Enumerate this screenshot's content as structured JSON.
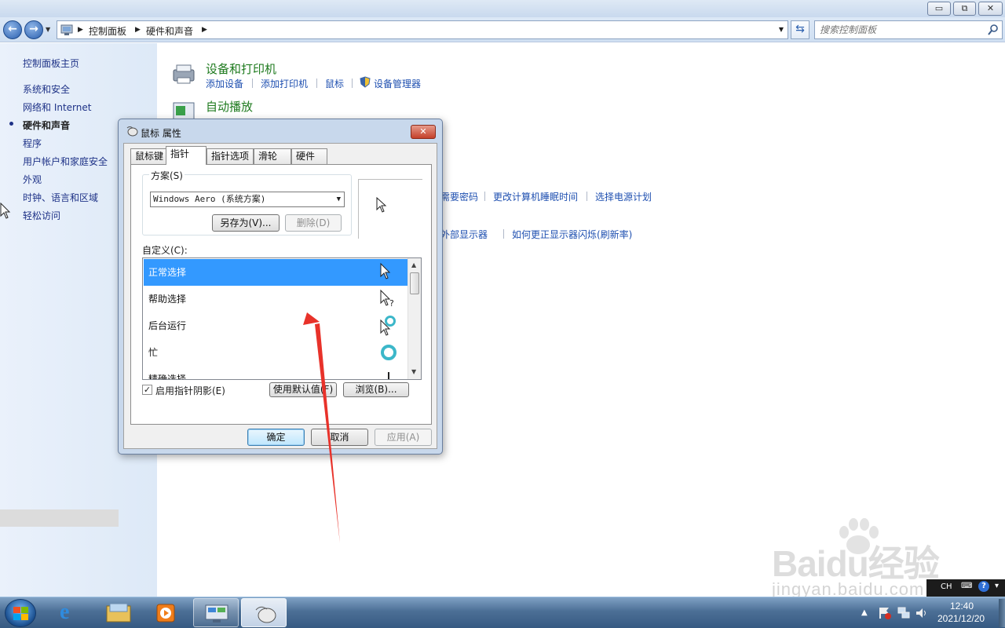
{
  "window": {
    "caption_buttons": {
      "minimize": "▭",
      "maximize": "⧉",
      "close": "✕"
    }
  },
  "addressbar": {
    "crumbs": [
      "控制面板",
      "硬件和声音"
    ],
    "search_placeholder": "搜索控制面板"
  },
  "sidebar": {
    "home": "控制面板主页",
    "items": [
      {
        "label": "系统和安全",
        "current": false
      },
      {
        "label": "网络和 Internet",
        "current": false
      },
      {
        "label": "硬件和声音",
        "current": true
      },
      {
        "label": "程序",
        "current": false
      },
      {
        "label": "用户帐户和家庭安全",
        "current": false
      },
      {
        "label": "外观",
        "current": false
      },
      {
        "label": "时钟、语言和区域",
        "current": false
      },
      {
        "label": "轻松访问",
        "current": false
      }
    ]
  },
  "main": {
    "devices": {
      "title": "设备和打印机",
      "links": [
        "添加设备",
        "添加打印机",
        "鼠标",
        "设备管理器"
      ]
    },
    "autoplay": {
      "title": "自动播放"
    },
    "power_links": [
      "需要密码",
      "更改计算机睡眠时间",
      "选择电源计划"
    ],
    "display_links": [
      "外部显示器",
      "如何更正显示器闪烁(刷新率)"
    ]
  },
  "dialog": {
    "title": "鼠标 属性",
    "close": "✕",
    "tabs": [
      "鼠标键",
      "指针",
      "指针选项",
      "滑轮",
      "硬件"
    ],
    "active_tab": "指针",
    "scheme": {
      "legend": "方案(S)",
      "selected": "Windows Aero (系统方案)",
      "save_as": "另存为(V)...",
      "delete": "删除(D)"
    },
    "custom_label": "自定义(C):",
    "cursors": [
      {
        "label": "正常选择",
        "icon": "arrow-cursor-icon",
        "selected": true
      },
      {
        "label": "帮助选择",
        "icon": "help-cursor-icon",
        "selected": false
      },
      {
        "label": "后台运行",
        "icon": "working-in-background-cursor-icon",
        "selected": false
      },
      {
        "label": "忙",
        "icon": "busy-cursor-icon",
        "selected": false
      },
      {
        "label": "精确选择",
        "icon": "precision-cursor-icon",
        "selected": false
      }
    ],
    "shadow": {
      "label": "启用指针阴影(E)",
      "checked": true
    },
    "use_default": "使用默认值(F)",
    "browse": "浏览(B)...",
    "ok": "确定",
    "cancel": "取消",
    "apply": "应用(A)"
  },
  "annotation": {
    "arrow_color": "#e8322a"
  },
  "watermark": {
    "logo": "Baidu经验",
    "url": "jingyan.baidu.com"
  },
  "taskbar": {
    "items": [
      "ie-icon",
      "explorer-icon",
      "media-player-icon",
      "control-panel-icon",
      "mouse-icon"
    ],
    "language": "CH",
    "time": "12:40",
    "date": "2021/12/20"
  },
  "colors": {
    "link": "#1e4fb0",
    "category_title": "#1e7a1e",
    "selection": "#3399ff"
  }
}
